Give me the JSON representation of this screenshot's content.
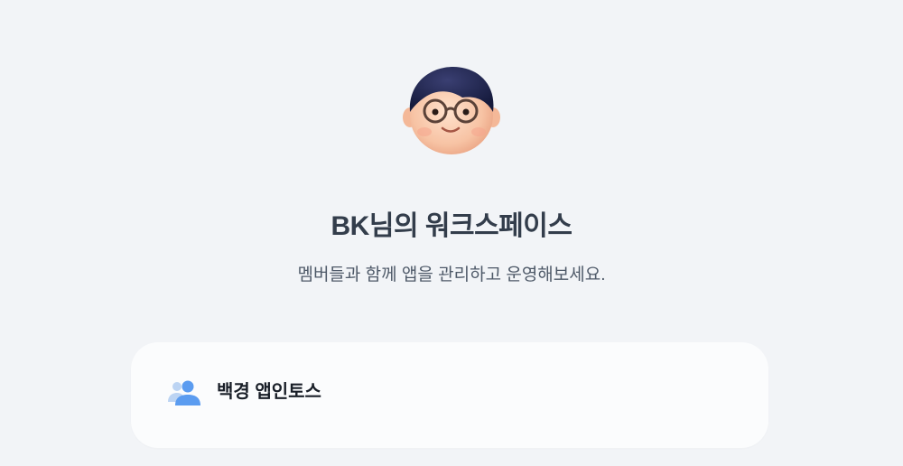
{
  "header": {
    "avatar_icon": "avatar-glasses-boy-icon",
    "title": "BK님의 워크스페이스",
    "subtitle": "멤버들과 함께 앱을 관리하고 운영해보세요."
  },
  "workspaces": [
    {
      "name": "백경 앱인토스",
      "icon": "people-icon"
    }
  ],
  "colors": {
    "background": "#f2f4f7",
    "card": "#fbfcfd",
    "title": "#333d4b",
    "people_icon_front": "#5b9cf0",
    "people_icon_back": "#bcd4f3"
  }
}
